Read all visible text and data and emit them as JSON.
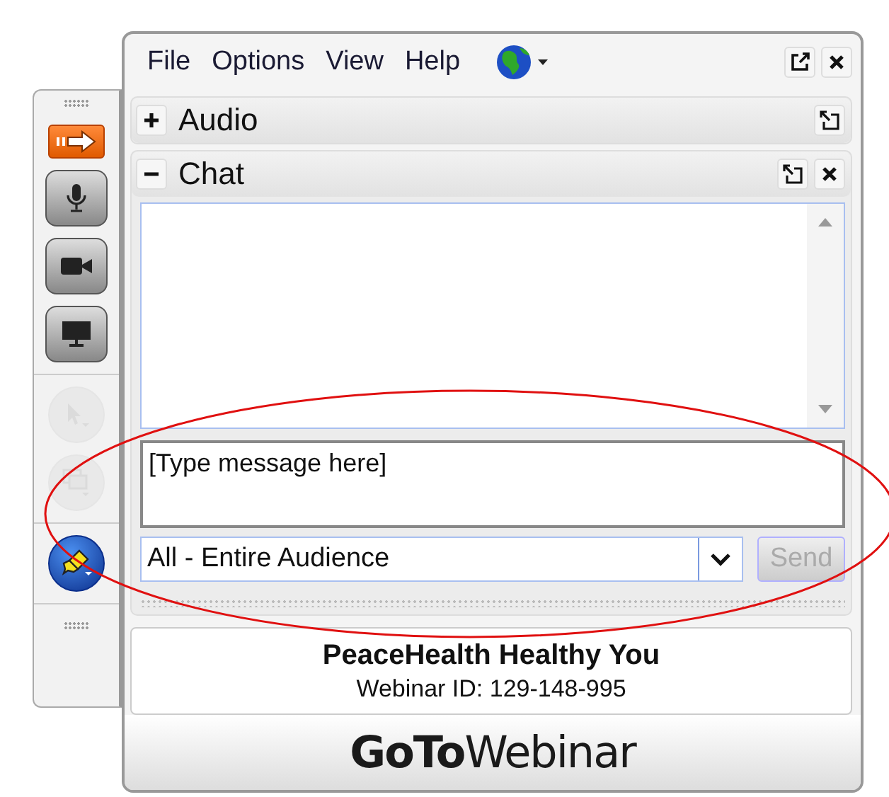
{
  "toolbar": [
    {
      "kind": "arrow",
      "selected": true,
      "disabled": false
    },
    {
      "kind": "microphone",
      "selected": false,
      "disabled": false
    },
    {
      "kind": "camera",
      "selected": false,
      "disabled": false
    },
    {
      "kind": "screen",
      "selected": false,
      "disabled": false
    },
    {
      "kind": "pointer",
      "selected": false,
      "disabled": true
    },
    {
      "kind": "screens",
      "selected": false,
      "disabled": true
    },
    {
      "kind": "highlighter",
      "selected": false,
      "disabled": false
    }
  ],
  "menu": [
    "File",
    "Options",
    "View",
    "Help"
  ],
  "panels": [
    {
      "title": "Audio",
      "expanded": false,
      "closable": false
    },
    {
      "title": "Chat",
      "expanded": true,
      "closable": true
    }
  ],
  "chat": {
    "placeholder": "[Type message here]",
    "recipient": "All - Entire Audience",
    "send": {
      "label": "Send",
      "disabled": true
    }
  },
  "info": {
    "title": "PeaceHealth Healthy You",
    "webinar_id": "Webinar ID: 129-148-995"
  },
  "logo": "**GoTo**Webinar"
}
